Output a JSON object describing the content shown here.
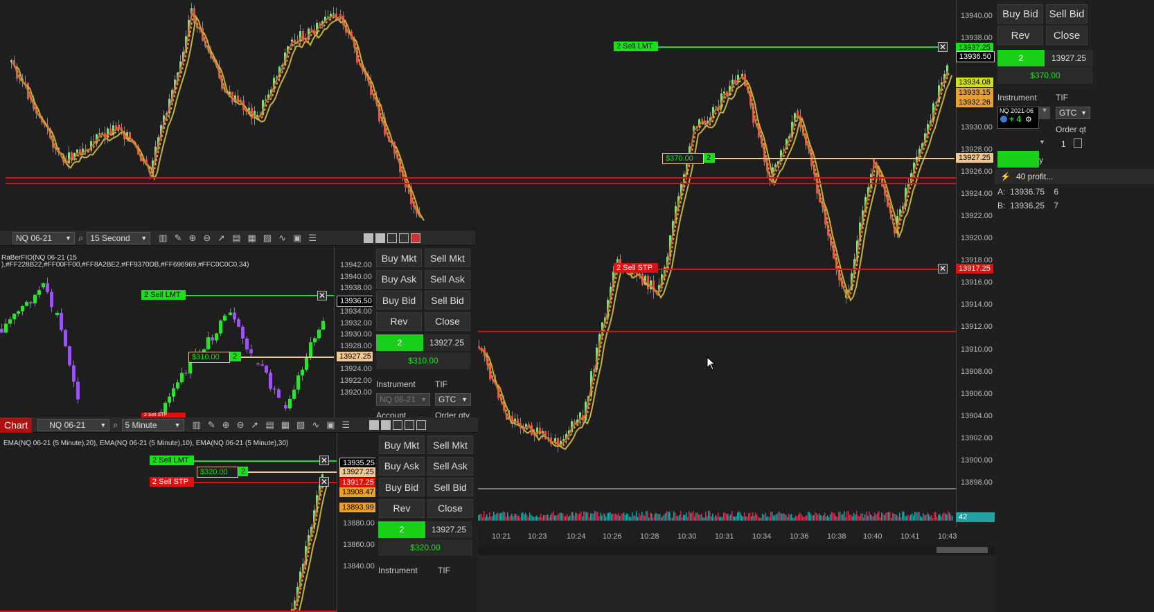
{
  "main_chart": {
    "price_ticks": [
      "13940.00",
      "13938.00",
      "13936.00",
      "13934.00",
      "13932.00",
      "13930.00",
      "13928.00",
      "13926.00",
      "13924.00",
      "13922.00",
      "13920.00",
      "13918.00",
      "13916.00",
      "13914.00",
      "13912.00",
      "13910.00",
      "13908.00",
      "13906.00",
      "13904.00",
      "13902.00",
      "13900.00",
      "13898.00"
    ],
    "time_ticks": [
      "10:21",
      "10:23",
      "10:24",
      "10:26",
      "10:28",
      "10:30",
      "10:31",
      "10:34",
      "10:36",
      "10:38",
      "10:40",
      "10:41",
      "10:43"
    ],
    "sell_lmt_label": "2  Sell LMT",
    "sell_stp_label": "2  Sell STP",
    "position_pnl": "$370.00",
    "position_qty": "2",
    "axis_tags": {
      "lmt": "13937.25",
      "last": "13936.50",
      "ema1": "13934.08",
      "ema2": "13933.15",
      "ema3": "13932.26",
      "avg": "13927.25",
      "stp": "13917.25",
      "volume": "42"
    },
    "colors": {
      "green": "#19e019",
      "red": "#e01010",
      "orange": "#e8a030",
      "tan": "#f0c890",
      "teal": "#20a0a0"
    }
  },
  "right_panel": {
    "buy_bid": "Buy Bid",
    "sell_bid": "Sell Bid",
    "rev": "Rev",
    "close": "Close",
    "qty": "2",
    "avg_price": "13927.25",
    "pnl": "$370.00",
    "instrument_label": "Instrument",
    "tif_label": "TIF",
    "instrument_value": "NQ 2021-06",
    "instrument_change": "+ 4",
    "tif_value": "GTC",
    "order_qty_label": "Order qt",
    "order_qty_value": "1",
    "strategy": "40 profit...",
    "ask_line": "A:  13936.75    6",
    "bid_line": "B:  13936.25    7",
    "letter_y": "y"
  },
  "chart2": {
    "instrument": "NQ 06-21",
    "interval": "15 Second",
    "indicator_text": "RaBerFIO(NQ 06-21 (15",
    "indicator_text2": "),#FF228B22,#FF00FF00,#FF8A2BE2,#FF9370DB,#FF696969,#FFC0C0C0,34)",
    "price_ticks": [
      "13942.00",
      "13940.00",
      "13938.00",
      "13936.00",
      "13934.00",
      "13932.00",
      "13930.00",
      "13928.00",
      "13926.00",
      "13924.00",
      "13922.00",
      "13920.00"
    ],
    "sell_lmt_label": "2  Sell LMT",
    "sell_stp_label": "2  Sell STP",
    "position_pnl": "$310.00",
    "position_qty": "2",
    "tag_last": "13936.50",
    "tag_avg": "13927.25",
    "buttons": [
      "Buy Mkt",
      "Sell Mkt",
      "Buy Ask",
      "Sell Ask",
      "Buy Bid",
      "Sell Bid",
      "Rev",
      "Close"
    ],
    "qty": "2",
    "avg_price": "13927.25",
    "pnl": "$310.00",
    "instrument_label": "Instrument",
    "tif_label": "TIF",
    "instrument_value": "NQ 06-21",
    "tif_value": "GTC",
    "account_label": "Account",
    "order_qty_label": "Order qty"
  },
  "chart3": {
    "chart_label": "Chart",
    "instrument": "NQ 06-21",
    "interval": "5 Minute",
    "indicator_text": "EMA(NQ 06-21 (5 Minute),20), EMA(NQ 06-21 (5 Minute),10), EMA(NQ 06-21 (5 Minute),30)",
    "price_ticks": [
      "13880.00",
      "13860.00",
      "13840.00"
    ],
    "sell_lmt_label": "2  Sell LMT",
    "sell_stp_label": "2  Sell STP",
    "position_pnl": "$320.00",
    "position_qty": "2",
    "tags": [
      "13935.25",
      "13927.25",
      "13917.25",
      "13908.47",
      "13893.99"
    ],
    "buttons": [
      "Buy Mkt",
      "Sell Mkt",
      "Buy Ask",
      "Sell Ask",
      "Buy Bid",
      "Sell Bid",
      "Rev",
      "Close"
    ],
    "qty": "2",
    "avg_price": "13927.25",
    "pnl": "$320.00",
    "instrument_label": "Instrument",
    "tif_label": "TIF"
  }
}
